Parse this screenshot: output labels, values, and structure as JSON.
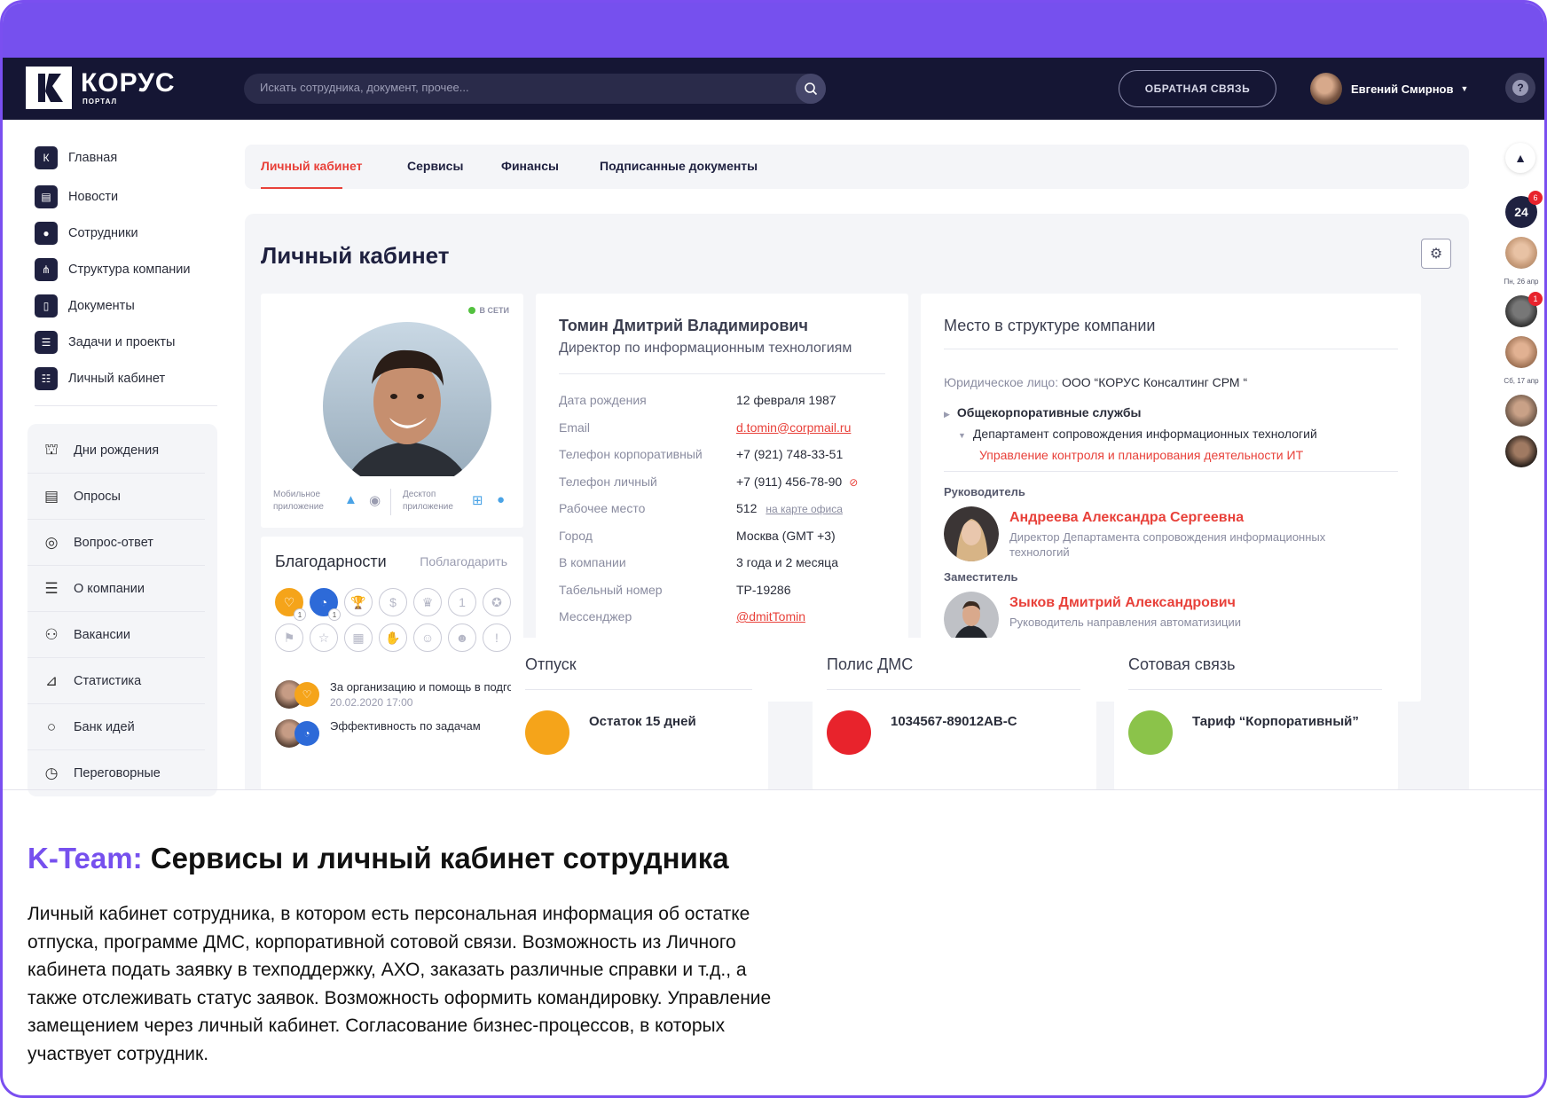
{
  "brand": {
    "name": "КОРУС",
    "subtitle": "ПОРТАЛ"
  },
  "search": {
    "placeholder": "Искать сотрудника, документ, прочее..."
  },
  "header": {
    "feedback_label": "ОБРАТНАЯ СВЯЗЬ",
    "user_name": "Евгений Смирнов",
    "help": "?"
  },
  "sidebar": {
    "nav": [
      {
        "label": "Главная",
        "icon": "korus-icon"
      },
      {
        "label": "Новости",
        "icon": "news-icon"
      },
      {
        "label": "Сотрудники",
        "icon": "user-icon"
      },
      {
        "label": "Структура компании",
        "icon": "structure-icon"
      },
      {
        "label": "Документы",
        "icon": "document-icon"
      },
      {
        "label": "Задачи и проекты",
        "icon": "tasks-icon"
      },
      {
        "label": "Личный кабинет",
        "icon": "cabinet-icon"
      }
    ],
    "widgets": [
      {
        "label": "Дни рождения",
        "icon": "cake-icon"
      },
      {
        "label": "Опросы",
        "icon": "poll-icon"
      },
      {
        "label": "Вопрос-ответ",
        "icon": "qa-icon"
      },
      {
        "label": "О компании",
        "icon": "company-icon"
      },
      {
        "label": "Вакансии",
        "icon": "vacancy-icon"
      },
      {
        "label": "Статистика",
        "icon": "chart-icon"
      },
      {
        "label": "Банк идей",
        "icon": "bulb-icon"
      },
      {
        "label": "Переговорные",
        "icon": "clock-icon"
      }
    ]
  },
  "tabs": [
    {
      "label": "Личный кабинет",
      "active": true
    },
    {
      "label": "Сервисы",
      "active": false
    },
    {
      "label": "Финансы",
      "active": false
    },
    {
      "label": "Подписанные документы",
      "active": false
    }
  ],
  "page": {
    "title": "Личный кабинет"
  },
  "profile": {
    "status": "В СЕТИ",
    "mobile_label_1": "Мобильное",
    "mobile_label_2": "приложение",
    "desktop_label_1": "Десктоп",
    "desktop_label_2": "приложение"
  },
  "thanks": {
    "title": "Благодарности",
    "action": "Поблагодарить",
    "badges_row1": [
      {
        "icon": "heart-icon",
        "glyph": "♡",
        "style": "filled-orange",
        "count": "1"
      },
      {
        "icon": "speed-icon",
        "glyph": "◔",
        "style": "filled-blue",
        "count": "1"
      },
      {
        "icon": "trophy-icon",
        "glyph": "🏆",
        "style": "",
        "count": ""
      },
      {
        "icon": "money-icon",
        "glyph": "$",
        "style": "",
        "count": ""
      },
      {
        "icon": "crown-icon",
        "glyph": "♛",
        "style": "",
        "count": ""
      },
      {
        "icon": "number-one-icon",
        "glyph": "1",
        "style": "",
        "count": ""
      },
      {
        "icon": "medal-icon",
        "glyph": "✪",
        "style": "",
        "count": ""
      }
    ],
    "badges_row2": [
      {
        "icon": "flag-icon",
        "glyph": "⚑",
        "style": "",
        "count": ""
      },
      {
        "icon": "star-icon",
        "glyph": "☆",
        "style": "",
        "count": ""
      },
      {
        "icon": "calendar-icon",
        "glyph": "▦",
        "style": "",
        "count": ""
      },
      {
        "icon": "hand-icon",
        "glyph": "✋",
        "style": "",
        "count": ""
      },
      {
        "icon": "smile-icon",
        "glyph": "☺",
        "style": "",
        "count": ""
      },
      {
        "icon": "happy-icon",
        "glyph": "☻",
        "style": "",
        "count": ""
      },
      {
        "icon": "exclamation-icon",
        "glyph": "!",
        "style": "",
        "count": ""
      }
    ],
    "items": [
      {
        "text": "За организацию и помощь в подго...",
        "date": "20.02.2020 17:00"
      },
      {
        "text": "Эффективность по задачам",
        "date": ""
      }
    ]
  },
  "person": {
    "name": "Томин Дмитрий Владимирович",
    "position": "Директор по информационным технологиям",
    "fields": [
      {
        "label": "Дата рождения",
        "value": "12 февраля 1987",
        "link": false
      },
      {
        "label": "Email",
        "value": "d.tomin@corpmail.ru",
        "link": true
      },
      {
        "label": "Телефон корпоративный",
        "value": "+7 (921) 748-33-51",
        "link": false
      },
      {
        "label": "Телефон личный",
        "value": "+7 (911) 456-78-90",
        "link": false
      },
      {
        "label": "Рабочее место",
        "value": "512",
        "link": false
      },
      {
        "label": "Город",
        "value": "Москва (GMT +3)",
        "link": false
      },
      {
        "label": "В компании",
        "value": "3 года и 2 месяца",
        "link": false
      },
      {
        "label": "Табельный номер",
        "value": "ТР-19286",
        "link": false
      },
      {
        "label": "Мессенджер",
        "value": "@dmitTomin",
        "link": true
      }
    ],
    "map_link": "на карте офиса"
  },
  "structure": {
    "title": "Место  в структуре компании",
    "legal_label": "Юридическое лицо:",
    "legal_value": "ООО “КОРУС Консалтинг СРМ “",
    "tree_l1": "Общекорпоративные службы",
    "tree_l2": "Департамент сопровождения информационных технологий",
    "tree_l3": "Управление контроля и планирования деятельности ИТ",
    "manager_label": "Руководитель",
    "manager_name": "Андреева Александра Сергеевна",
    "manager_pos": "Директор Департамента сопровождения информационных технологий",
    "deputy_label": "Заместитель",
    "deputy_name": "Зыков Дмитрий Александрович",
    "deputy_pos": "Руководитель направления автоматизиции"
  },
  "mini_cards": [
    {
      "title": "Отпуск",
      "text": "Остаток 15 дней",
      "color": "#f5a41a",
      "icon": "palm-icon"
    },
    {
      "title": "Полис ДМС",
      "text": "1034567-89012АВ-С",
      "color": "#e8232c",
      "icon": "pulse-icon"
    },
    {
      "title": "Сотовая связь",
      "text": "Тариф “Корпоративный”",
      "color": "#8bc34a",
      "icon": "phone-icon"
    }
  ],
  "rail": {
    "counter": "24",
    "counter_badge": "6",
    "date1": "Пн, 26 апр",
    "badge2": "1",
    "date2": "Сб, 17 апр"
  },
  "caption": {
    "accent": "K-Team:",
    "title": " Сервисы и личный кабинет сотрудника",
    "body": "Личный кабинет сотрудника, в котором есть персональная информация об остатке отпуска, программе ДМС, корпоративной сотовой связи. Возможность из Личного кабинета подать заявку в техподдержку, АХО, заказать различные справки и т.д., а также отслеживать статус заявок. Возможность оформить командировку. Управление замещением через личный кабинет. Согласование бизнес-процессов, в которых участвует сотрудник."
  }
}
